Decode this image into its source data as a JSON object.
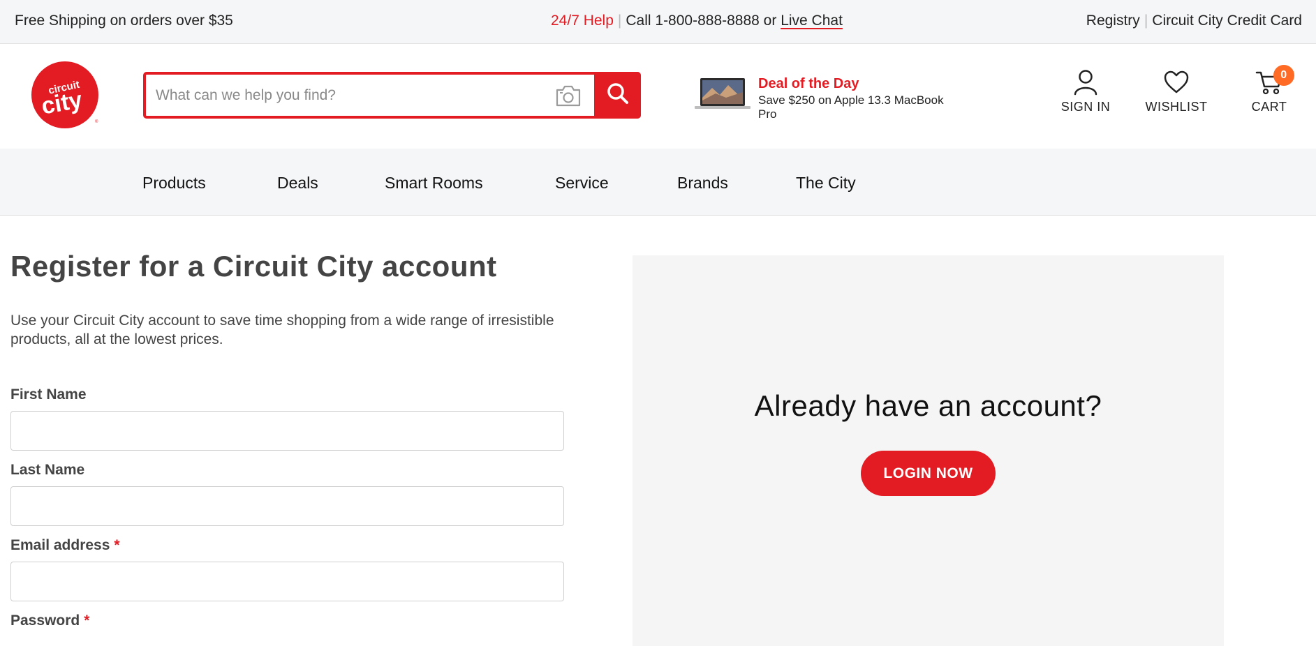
{
  "topbar": {
    "shipping": "Free Shipping on orders over $35",
    "help": "24/7 Help",
    "call": "Call 1-800-888-8888 or",
    "live_chat": "Live Chat",
    "registry": "Registry",
    "credit_card": "Circuit City Credit Card"
  },
  "header": {
    "logo_text_top": "circuit",
    "logo_text_main": "city",
    "search_placeholder": "What can we help you find?",
    "deal_title": "Deal of the Day",
    "deal_desc": "Save $250 on Apple 13.3 MacBook Pro",
    "sign_in": "SIGN IN",
    "wishlist": "WISHLIST",
    "cart": "CART",
    "cart_count": "0"
  },
  "nav": {
    "items": [
      "Products",
      "Deals",
      "Smart Rooms",
      "Service",
      "Brands",
      "The City"
    ]
  },
  "register": {
    "title": "Register for a Circuit City account",
    "description": "Use your Circuit City account to save time shopping from a wide range of irresistible products, all at the lowest prices.",
    "fields": {
      "first_name": "First Name",
      "last_name": "Last Name",
      "email": "Email address",
      "password": "Password"
    },
    "required_marker": "*"
  },
  "login": {
    "heading": "Already have an account?",
    "button": "LOGIN NOW"
  },
  "colors": {
    "brand_red": "#e31b23",
    "badge_orange": "#ff6a25",
    "bar_bg": "#f5f6f8",
    "panel_bg": "#f5f5f5"
  },
  "icons": [
    "circuit-city-logo",
    "camera-icon",
    "search-icon",
    "macbook-thumbnail",
    "user-icon",
    "heart-icon",
    "cart-icon"
  ]
}
